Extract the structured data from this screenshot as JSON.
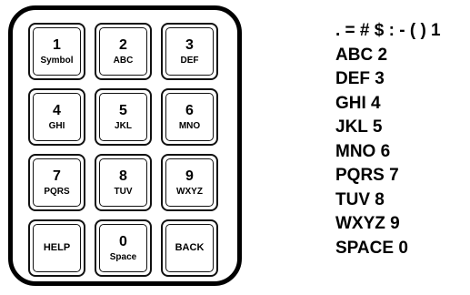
{
  "keypad": {
    "keys": [
      {
        "digit": "1",
        "letters": "Symbol"
      },
      {
        "digit": "2",
        "letters": "ABC"
      },
      {
        "digit": "3",
        "letters": "DEF"
      },
      {
        "digit": "4",
        "letters": "GHI"
      },
      {
        "digit": "5",
        "letters": "JKL"
      },
      {
        "digit": "6",
        "letters": "MNO"
      },
      {
        "digit": "7",
        "letters": "PQRS"
      },
      {
        "digit": "8",
        "letters": "TUV"
      },
      {
        "digit": "9",
        "letters": "WXYZ"
      },
      {
        "digit": "",
        "letters": "HELP"
      },
      {
        "digit": "0",
        "letters": "Space"
      },
      {
        "digit": "",
        "letters": "BACK"
      }
    ]
  },
  "legend": [
    ". = # $ : - ( ) 1",
    "ABC 2",
    "DEF 3",
    "GHI 4",
    "JKL 5",
    "MNO 6",
    "PQRS 7",
    "TUV 8",
    "WXYZ 9",
    "SPACE 0"
  ]
}
